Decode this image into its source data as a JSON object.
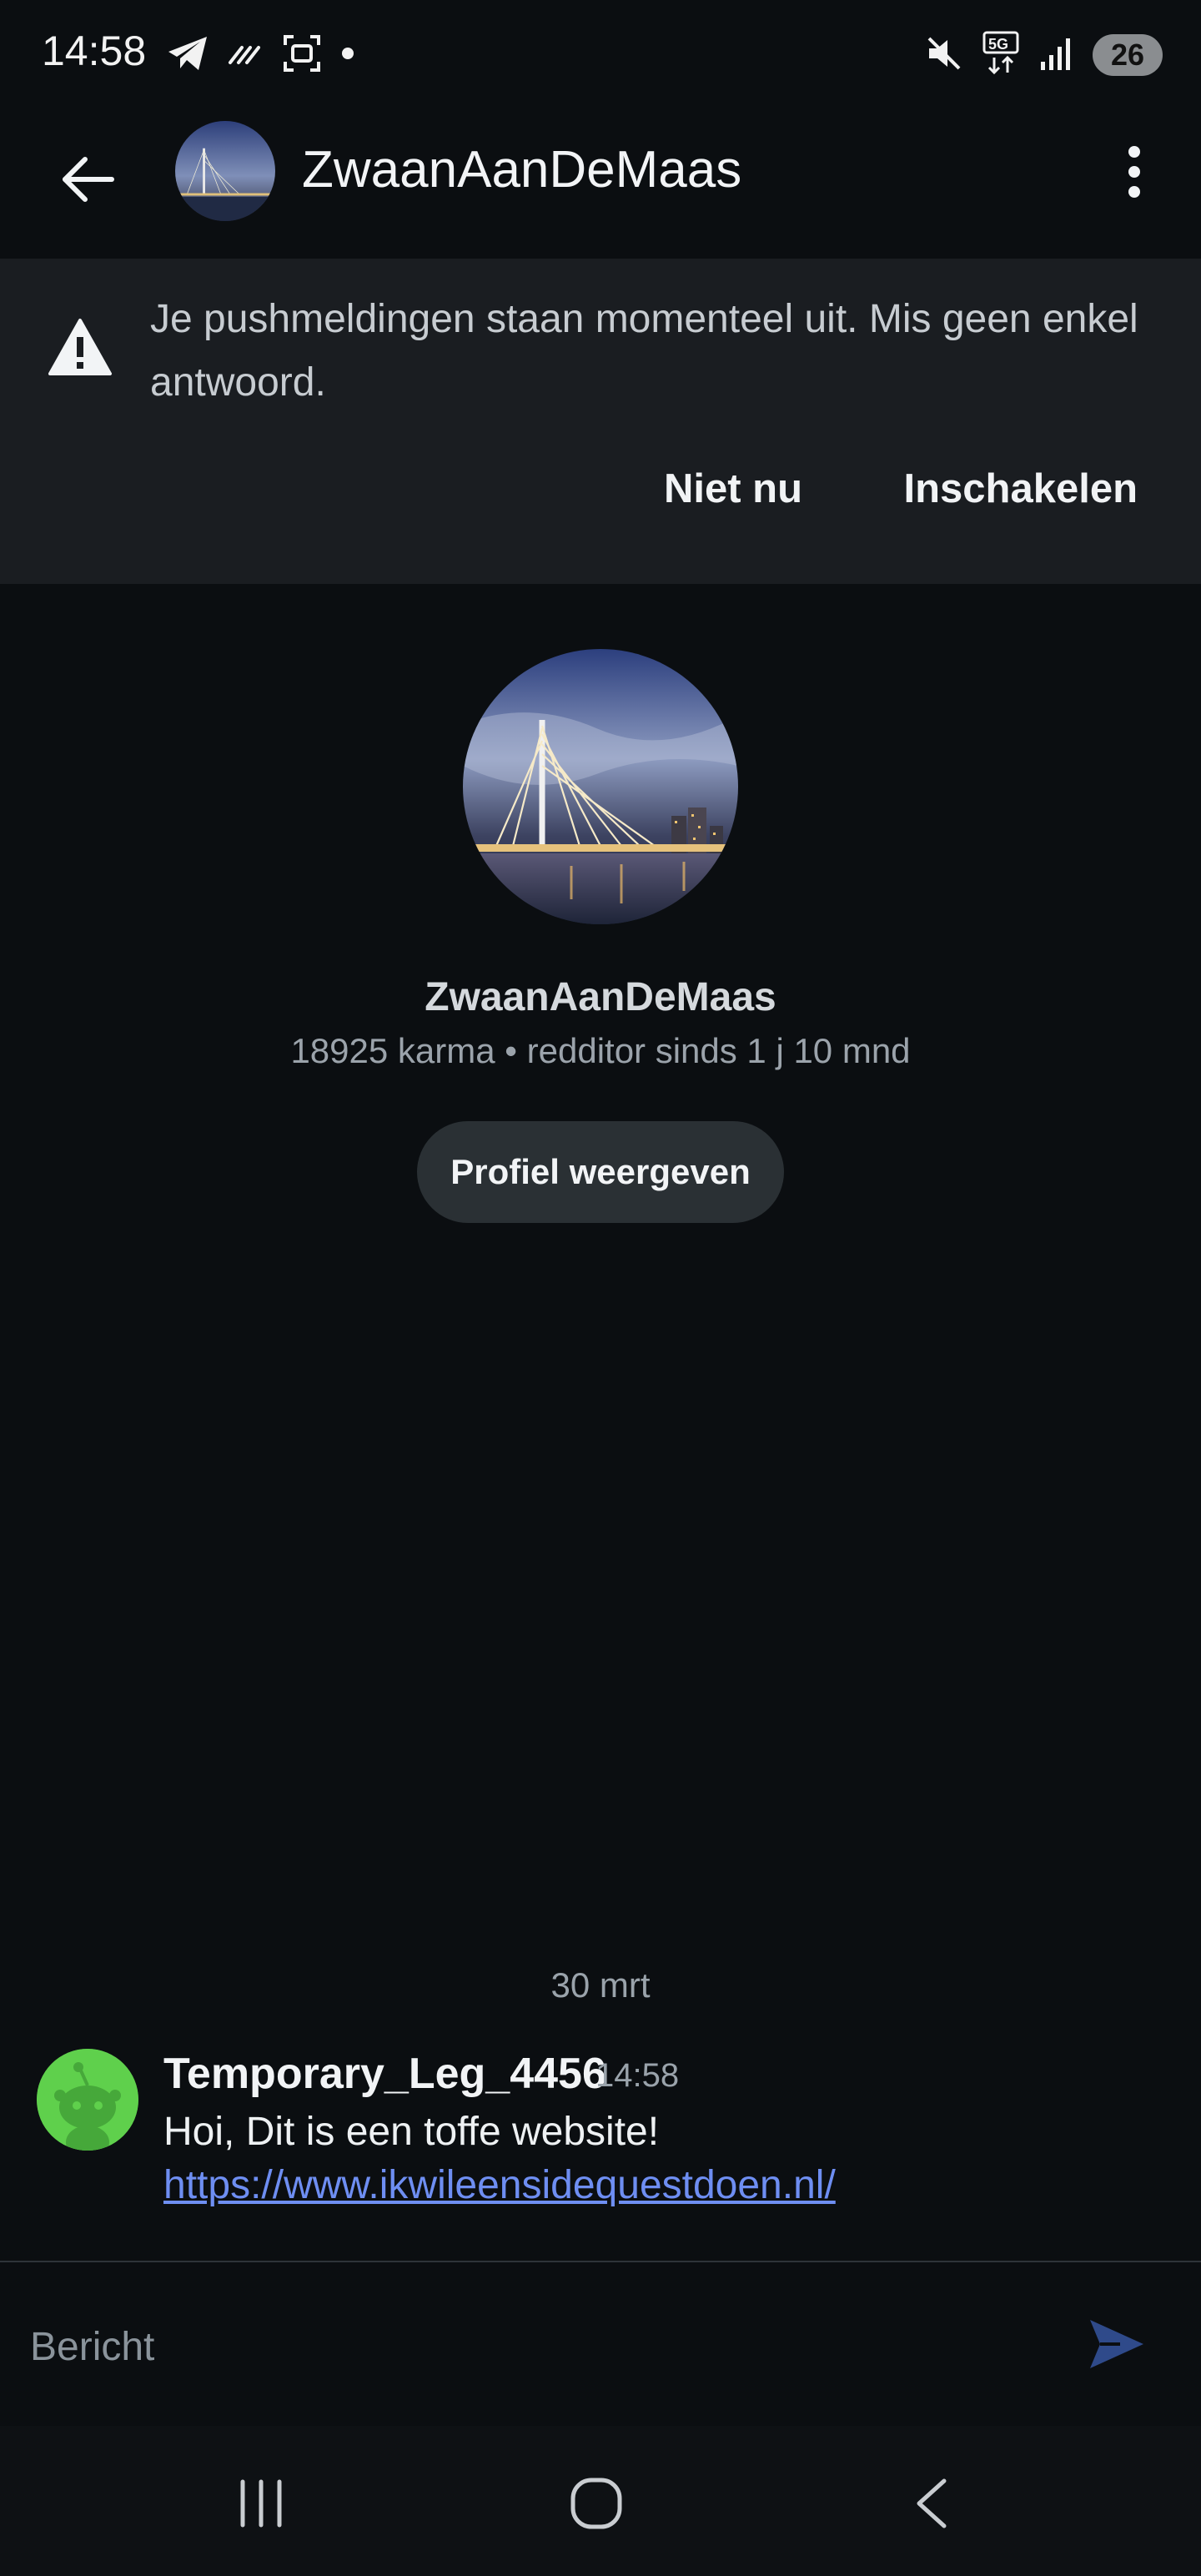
{
  "status_bar": {
    "time": "14:58",
    "battery_level": "26",
    "icons": [
      "telegram-icon",
      "signal-stripes-icon",
      "screenshot-icon",
      "dot-icon",
      "mute-icon",
      "5g-icon",
      "signal-bars-icon",
      "battery-icon"
    ]
  },
  "header": {
    "title": "ZwaanAanDeMaas",
    "back_icon": "arrow-left-icon",
    "more_icon": "more-vertical-icon"
  },
  "banner": {
    "text": "Je pushmeldingen staan momenteel uit. Mis geen enkel antwoord.",
    "not_now_label": "Niet nu",
    "enable_label": "Inschakelen",
    "icon": "warning-icon"
  },
  "profile": {
    "name": "ZwaanAanDeMaas",
    "meta": "18925 karma • redditor sinds 1 j 10 mnd",
    "view_profile_label": "Profiel weergeven"
  },
  "conversation": {
    "date_separator": "30 mrt",
    "messages": [
      {
        "author": "Temporary_Leg_4456",
        "time": "14:58",
        "text": "Hoi, Dit is een toffe website!",
        "link": "https://www.ikwileensidequestdoen.nl/"
      }
    ]
  },
  "composer": {
    "placeholder": "Bericht",
    "send_icon": "send-icon"
  },
  "colors": {
    "background": "#0b0e11",
    "banner_background": "#1a1d21",
    "link": "#6e8ef2",
    "send": "#2f4a8a",
    "avatar_green": "#5fd04c"
  }
}
